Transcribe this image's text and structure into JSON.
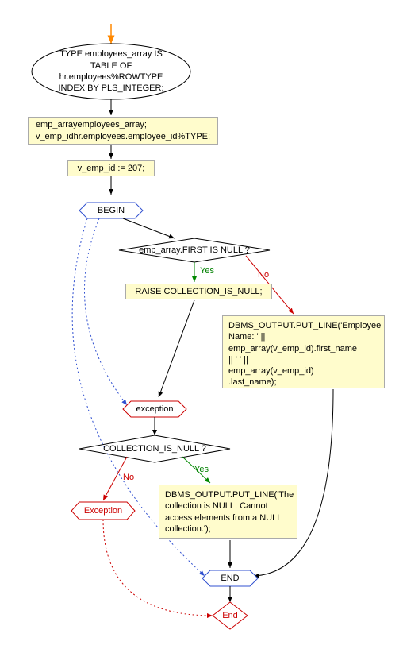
{
  "nodes": {
    "type_decl": "TYPE employees_array IS\nTABLE OF hr.employees%ROWTYPE\nINDEX BY PLS_INTEGER;",
    "var_decl": "emp_arrayemployees_array;\nv_emp_idhr.employees.employee_id%TYPE;",
    "assign": "v_emp_id := 207;",
    "begin": "BEGIN",
    "cond1": "emp_array.FIRST IS NULL ?",
    "raise": "RAISE COLLECTION_IS_NULL;",
    "dbms_name": "DBMS_OUTPUT.PUT_LINE('Employee Name: ' ||\nemp_array(v_emp_id).first_name\n|| ' ' ||\nemp_array(v_emp_id)\n.last_name);",
    "exception_hex": "exception",
    "cond2": "COLLECTION_IS_NULL ?",
    "exception_red": "Exception",
    "dbms_null": "DBMS_OUTPUT.PUT_LINE('The collection is NULL. Cannot access elements from a NULL collection.');",
    "end_hex": "END",
    "end_diamond": "End"
  },
  "labels": {
    "yes1": "Yes",
    "no1": "No",
    "yes2": "Yes",
    "no2": "No"
  },
  "chart_data": {
    "type": "flowchart",
    "title": "",
    "start": "entry_arrow",
    "nodes_list": [
      {
        "id": "type_decl",
        "shape": "ellipse",
        "text": "TYPE employees_array IS TABLE OF hr.employees%ROWTYPE INDEX BY PLS_INTEGER;"
      },
      {
        "id": "var_decl",
        "shape": "rect",
        "text": "emp_arrayemployees_array; v_emp_idhr.employees.employee_id%TYPE;"
      },
      {
        "id": "assign",
        "shape": "rect",
        "text": "v_emp_id := 207;"
      },
      {
        "id": "begin",
        "shape": "hexagon",
        "text": "BEGIN",
        "color": "blue"
      },
      {
        "id": "cond1",
        "shape": "diamond",
        "text": "emp_array.FIRST IS NULL ?"
      },
      {
        "id": "raise",
        "shape": "rect",
        "text": "RAISE COLLECTION_IS_NULL;"
      },
      {
        "id": "dbms_name",
        "shape": "rect",
        "text": "DBMS_OUTPUT.PUT_LINE('Employee Name: ' || emp_array(v_emp_id).first_name || ' ' || emp_array(v_emp_id).last_name);"
      },
      {
        "id": "exception_hex",
        "shape": "hexagon",
        "text": "exception",
        "color": "red"
      },
      {
        "id": "cond2",
        "shape": "diamond",
        "text": "COLLECTION_IS_NULL ?"
      },
      {
        "id": "exception_red",
        "shape": "hexagon",
        "text": "Exception",
        "color": "red"
      },
      {
        "id": "dbms_null",
        "shape": "rect",
        "text": "DBMS_OUTPUT.PUT_LINE('The collection is NULL. Cannot access elements from a NULL collection.');"
      },
      {
        "id": "end_hex",
        "shape": "hexagon",
        "text": "END",
        "color": "blue"
      },
      {
        "id": "end_diamond",
        "shape": "diamond",
        "text": "End",
        "color": "red"
      }
    ],
    "edges": [
      {
        "from": "entry",
        "to": "type_decl"
      },
      {
        "from": "type_decl",
        "to": "var_decl"
      },
      {
        "from": "var_decl",
        "to": "assign"
      },
      {
        "from": "assign",
        "to": "begin"
      },
      {
        "from": "begin",
        "to": "cond1"
      },
      {
        "from": "cond1",
        "to": "raise",
        "label": "Yes",
        "color": "green"
      },
      {
        "from": "cond1",
        "to": "dbms_name",
        "label": "No",
        "color": "red"
      },
      {
        "from": "raise",
        "to": "exception_hex"
      },
      {
        "from": "exception_hex",
        "to": "cond2"
      },
      {
        "from": "cond2",
        "to": "dbms_null",
        "label": "Yes",
        "color": "green"
      },
      {
        "from": "cond2",
        "to": "exception_red",
        "label": "No",
        "color": "red"
      },
      {
        "from": "dbms_null",
        "to": "end_hex"
      },
      {
        "from": "dbms_name",
        "to": "end_hex"
      },
      {
        "from": "end_hex",
        "to": "end_diamond"
      },
      {
        "from": "begin",
        "to": "exception_hex",
        "style": "dotted",
        "color": "blue"
      },
      {
        "from": "begin",
        "to": "end_hex",
        "style": "dotted",
        "color": "blue"
      },
      {
        "from": "exception_red",
        "to": "end_diamond",
        "style": "dotted",
        "color": "red"
      }
    ]
  }
}
